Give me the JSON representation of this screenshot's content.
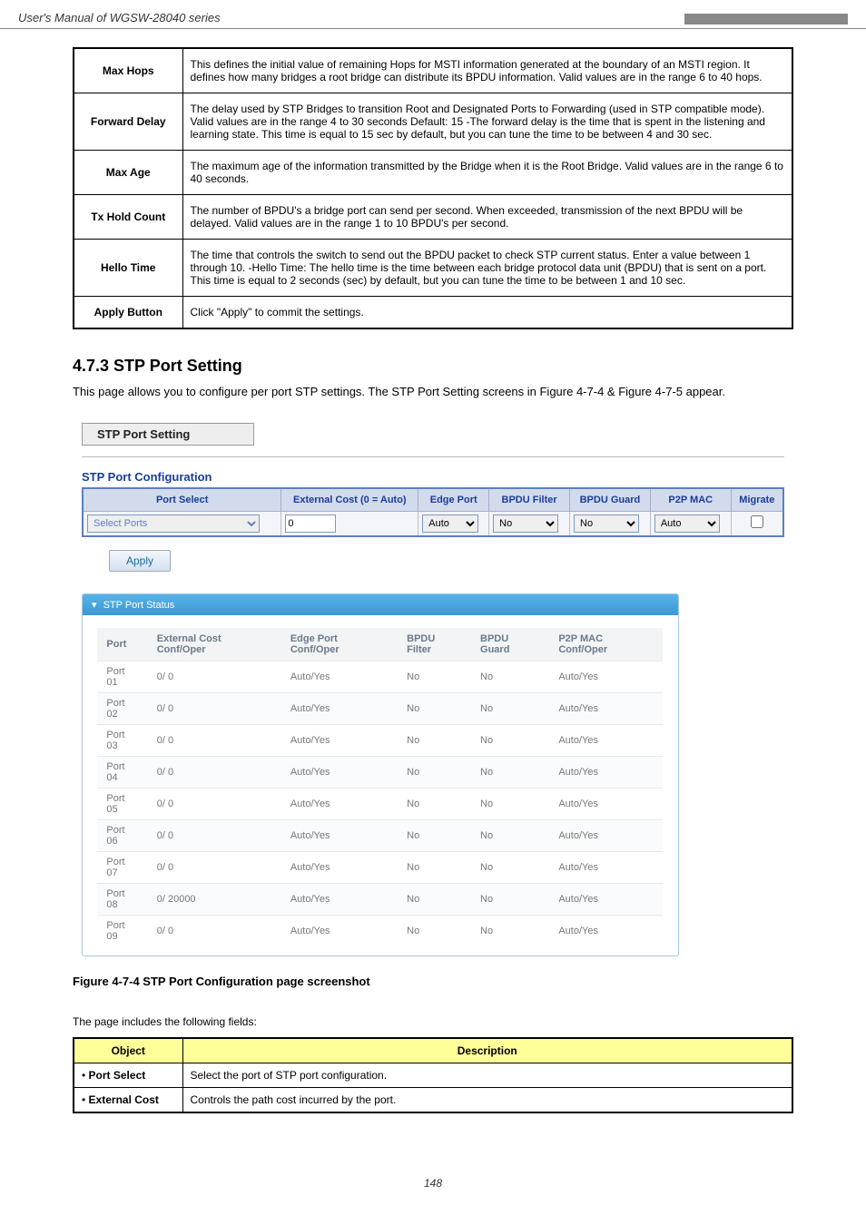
{
  "header": {
    "left": "User's Manual of WGSW-28040 series",
    "right": ""
  },
  "params_table": [
    {
      "label": "Max Hops",
      "desc": "This defines the initial value of remaining Hops for MSTI information generated at the boundary of an MSTI region. It defines how many bridges a root bridge can distribute its BPDU information. Valid values are in the range 6 to 40 hops."
    },
    {
      "label": "Forward Delay",
      "desc": "The delay used by STP Bridges to transition Root and Designated Ports to Forwarding (used in STP compatible mode). Valid values are in the range 4 to 30 seconds\nDefault: 15\n-The forward delay is the time that is spent in the listening and learning state. This time is equal to 15 sec by default, but you can tune the time to be between 4 and 30 sec."
    },
    {
      "label": "Max Age",
      "desc": "The maximum age of the information transmitted by the Bridge when it is the Root Bridge. Valid values are in the range 6 to 40 seconds."
    },
    {
      "label": "Tx Hold Count",
      "desc": "The number of BPDU's a bridge port can send per second. When exceeded, transmission of the next BPDU will be delayed. Valid values are in the range 1 to 10 BPDU's per second."
    },
    {
      "label": "Hello Time",
      "desc": "The time that controls the switch to send out the BPDU packet to check STP current status.\nEnter a value between 1 through 10.\n-Hello Time: The hello time is the time between each bridge protocol data unit (BPDU) that is sent on a port. This time is equal to 2 seconds (sec) by default, but you can tune the time to be between 1 and 10 sec."
    },
    {
      "label": "Apply Button",
      "desc": "Click \"Apply\" to commit the settings."
    }
  ],
  "section": {
    "title": "4.7.3 STP Port Setting",
    "desc": "This page allows you to configure per port STP settings. The STP Port Setting screens in Figure 4-7-4 & Figure 4-7-5 appear."
  },
  "screenshot": {
    "title_bar": "STP Port Setting",
    "config_title": "STP Port Configuration",
    "columns": [
      "Port Select",
      "External Cost (0 = Auto)",
      "Edge Port",
      "BPDU Filter",
      "BPDU Guard",
      "P2P MAC",
      "Migrate"
    ],
    "row": {
      "port_select": "Select Ports",
      "external_cost": "0",
      "edge_port": "Auto",
      "bpdu_filter": "No",
      "bpdu_guard": "No",
      "p2p_mac": "Auto"
    },
    "apply": "Apply",
    "status_title": "STP Port Status",
    "status_columns": [
      "Port",
      "External Cost Conf/Oper",
      "Edge Port Conf/Oper",
      "BPDU Filter",
      "BPDU Guard",
      "P2P MAC Conf/Oper"
    ],
    "status_rows": [
      {
        "port": "Port 01",
        "cost": "0/ 0",
        "edge": "Auto/Yes",
        "bfilter": "No",
        "bguard": "No",
        "p2p": "Auto/Yes"
      },
      {
        "port": "Port 02",
        "cost": "0/ 0",
        "edge": "Auto/Yes",
        "bfilter": "No",
        "bguard": "No",
        "p2p": "Auto/Yes"
      },
      {
        "port": "Port 03",
        "cost": "0/ 0",
        "edge": "Auto/Yes",
        "bfilter": "No",
        "bguard": "No",
        "p2p": "Auto/Yes"
      },
      {
        "port": "Port 04",
        "cost": "0/ 0",
        "edge": "Auto/Yes",
        "bfilter": "No",
        "bguard": "No",
        "p2p": "Auto/Yes"
      },
      {
        "port": "Port 05",
        "cost": "0/ 0",
        "edge": "Auto/Yes",
        "bfilter": "No",
        "bguard": "No",
        "p2p": "Auto/Yes"
      },
      {
        "port": "Port 06",
        "cost": "0/ 0",
        "edge": "Auto/Yes",
        "bfilter": "No",
        "bguard": "No",
        "p2p": "Auto/Yes"
      },
      {
        "port": "Port 07",
        "cost": "0/ 0",
        "edge": "Auto/Yes",
        "bfilter": "No",
        "bguard": "No",
        "p2p": "Auto/Yes"
      },
      {
        "port": "Port 08",
        "cost": "0/ 20000",
        "edge": "Auto/Yes",
        "bfilter": "No",
        "bguard": "No",
        "p2p": "Auto/Yes"
      },
      {
        "port": "Port 09",
        "cost": "0/ 0",
        "edge": "Auto/Yes",
        "bfilter": "No",
        "bguard": "No",
        "p2p": "Auto/Yes"
      }
    ]
  },
  "figure_caption": "Figure 4-7-4 STP Port Configuration page screenshot",
  "objects_line": "The page includes the following fields:",
  "fields_table": {
    "header": [
      "Object",
      "Description"
    ],
    "rows": [
      {
        "obj": "Port Select",
        "desc": "Select the port of STP port configuration."
      },
      {
        "obj": "External Cost",
        "desc": "Controls the path cost incurred by the port."
      }
    ]
  },
  "footer": "148"
}
